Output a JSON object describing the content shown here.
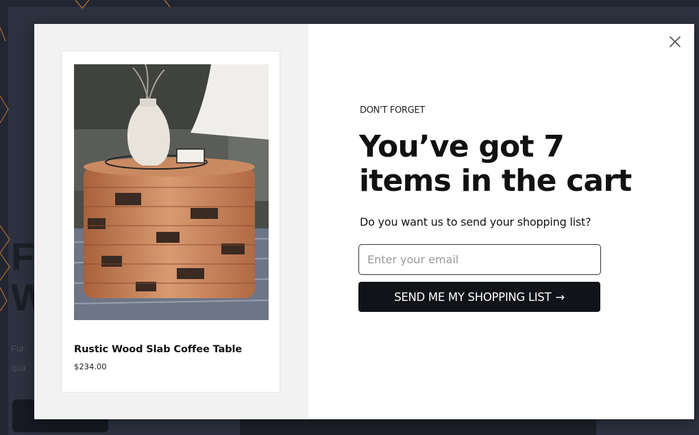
{
  "background_page": {
    "heading_line1": "F",
    "heading_line2": "W",
    "text_line1": "Fur",
    "text_line2": "qua"
  },
  "modal": {
    "product": {
      "name": "Rustic Wood Slab Coffee Table",
      "price": "$234.00"
    },
    "eyebrow": "DON'T FORGET",
    "headline_line1": "You’ve got 7",
    "headline_line2": "items in the cart",
    "subtext": "Do you want us to send your shopping list?",
    "email": {
      "value": "",
      "placeholder": "Enter your email"
    },
    "submit_label": "SEND ME MY SHOPPING LIST",
    "submit_arrow": "→",
    "close_icon": "close-icon"
  },
  "colors": {
    "overlay": "#222633",
    "accent_pattern": "#e8892f",
    "button_bg": "#111318"
  }
}
